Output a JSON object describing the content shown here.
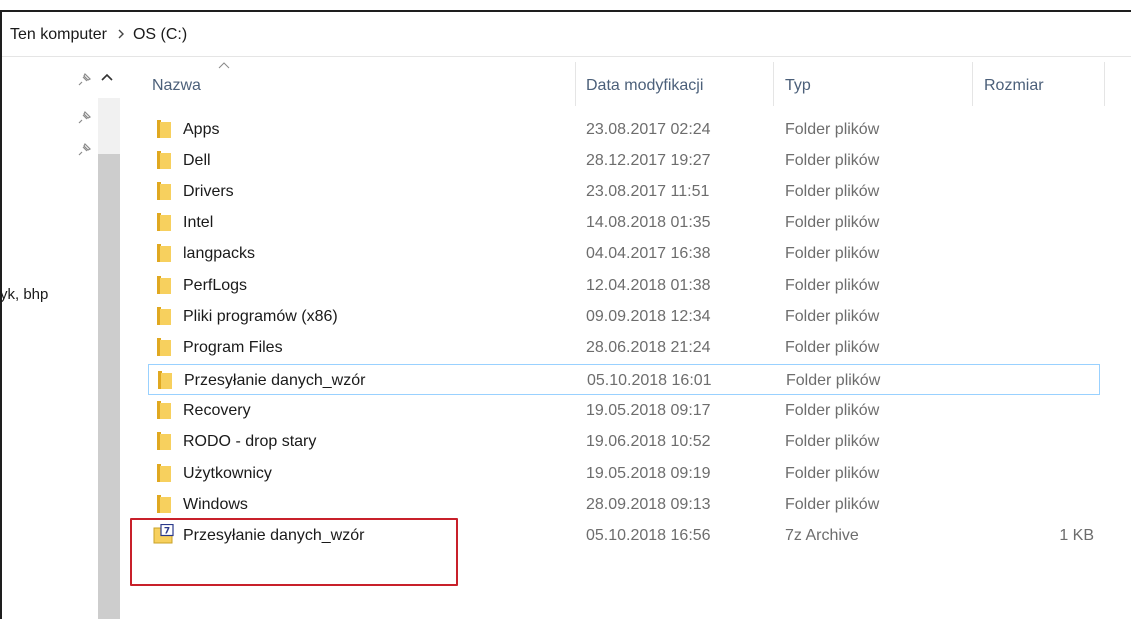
{
  "breadcrumb": {
    "items": [
      "Ten komputer",
      "OS (C:)"
    ],
    "separator": ">"
  },
  "nav": {
    "partial_label": "yk, bhp"
  },
  "columns": {
    "name": "Nazwa",
    "date": "Data modyfikacji",
    "type": "Typ",
    "size": "Rozmiar"
  },
  "files": [
    {
      "name": "Apps",
      "date": "23.08.2017 02:24",
      "type": "Folder plików",
      "size": "",
      "icon": "folder-icon"
    },
    {
      "name": "Dell",
      "date": "28.12.2017 19:27",
      "type": "Folder plików",
      "size": "",
      "icon": "folder-icon"
    },
    {
      "name": "Drivers",
      "date": "23.08.2017 11:51",
      "type": "Folder plików",
      "size": "",
      "icon": "folder-icon"
    },
    {
      "name": "Intel",
      "date": "14.08.2018 01:35",
      "type": "Folder plików",
      "size": "",
      "icon": "folder-icon"
    },
    {
      "name": "langpacks",
      "date": "04.04.2017 16:38",
      "type": "Folder plików",
      "size": "",
      "icon": "folder-icon"
    },
    {
      "name": "PerfLogs",
      "date": "12.04.2018 01:38",
      "type": "Folder plików",
      "size": "",
      "icon": "folder-icon"
    },
    {
      "name": "Pliki programów (x86)",
      "date": "09.09.2018 12:34",
      "type": "Folder plików",
      "size": "",
      "icon": "folder-icon"
    },
    {
      "name": "Program Files",
      "date": "28.06.2018 21:24",
      "type": "Folder plików",
      "size": "",
      "icon": "folder-icon"
    },
    {
      "name": "Przesyłanie danych_wzór",
      "date": "05.10.2018 16:01",
      "type": "Folder plików",
      "size": "",
      "icon": "folder-icon",
      "selected": true
    },
    {
      "name": "Recovery",
      "date": "19.05.2018 09:17",
      "type": "Folder plików",
      "size": "",
      "icon": "folder-icon"
    },
    {
      "name": "RODO - drop stary",
      "date": "19.06.2018 10:52",
      "type": "Folder plików",
      "size": "",
      "icon": "folder-icon"
    },
    {
      "name": "Użytkownicy",
      "date": "19.05.2018 09:19",
      "type": "Folder plików",
      "size": "",
      "icon": "folder-icon"
    },
    {
      "name": "Windows",
      "date": "28.09.2018 09:13",
      "type": "Folder plików",
      "size": "",
      "icon": "folder-icon"
    },
    {
      "name": "Przesyłanie danych_wzór",
      "date": "05.10.2018 16:56",
      "type": "7z Archive",
      "size": "1 KB",
      "icon": "archive-icon"
    }
  ],
  "colors": {
    "selection_border": "#99d1ff",
    "highlight_box": "#c8202a",
    "folder": "#f2c94c",
    "header_text": "#4c607a"
  }
}
